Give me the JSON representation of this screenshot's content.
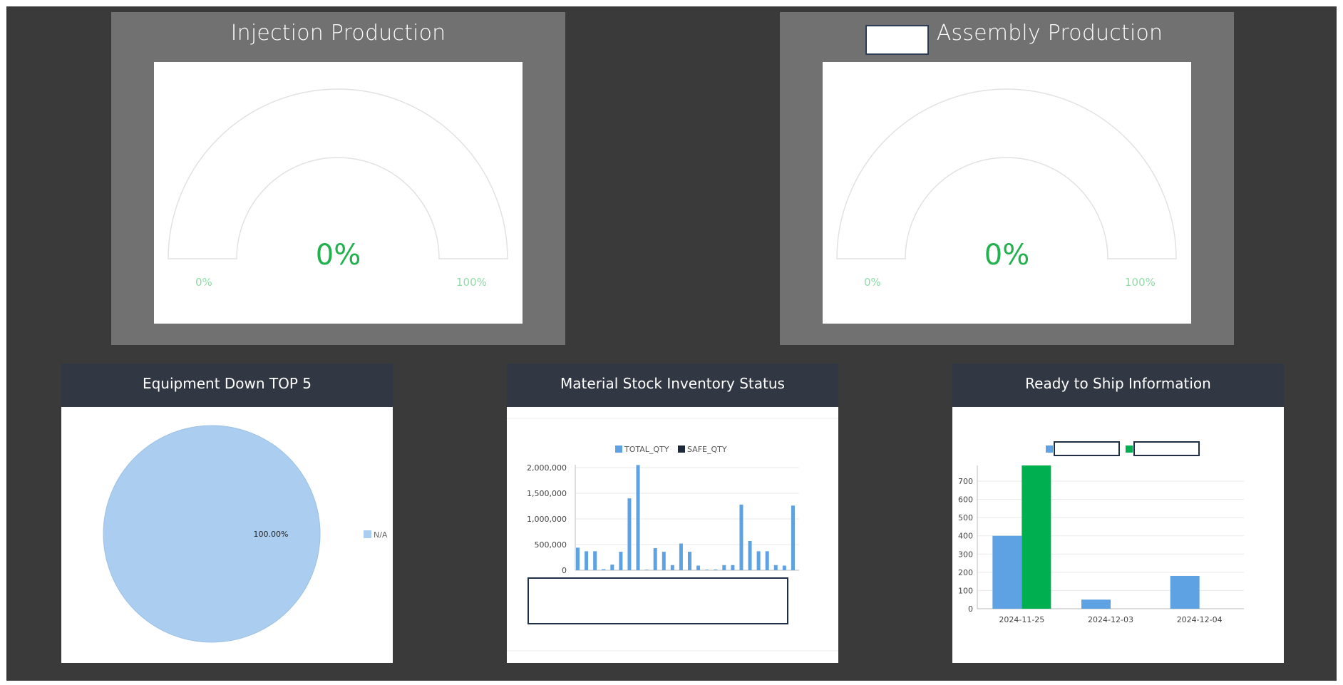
{
  "gauges": [
    {
      "title": "Injection Production",
      "value_label": "0%",
      "min_label": "0%",
      "max_label": "100%",
      "value": 0
    },
    {
      "title": "Assembly Production",
      "value_label": "0%",
      "min_label": "0%",
      "max_label": "100%",
      "value": 0
    }
  ],
  "panels": {
    "equipment": {
      "title": "Equipment Down TOP 5"
    },
    "material": {
      "title": "Material Stock Inventory Status"
    },
    "ship": {
      "title": "Ready to Ship Information"
    }
  },
  "colors": {
    "blue": "#5ea2e3",
    "navy": "#1e2a3a",
    "green": "#00b050",
    "pie": "#abcdef"
  },
  "chart_data": [
    {
      "type": "pie",
      "categories": [
        "N/A"
      ],
      "values": [
        100.0
      ],
      "slice_label": "100.00%"
    },
    {
      "type": "bar",
      "series": [
        {
          "name": "TOTAL_QTY",
          "values": [
            440000,
            370000,
            370000,
            20000,
            110000,
            360000,
            1400000,
            2050000,
            0,
            430000,
            360000,
            100000,
            520000,
            360000,
            90000,
            0,
            10000,
            100000,
            100000,
            1280000,
            570000,
            370000,
            370000,
            100000,
            90000,
            1260000
          ]
        },
        {
          "name": "SAFE_QTY",
          "values": []
        }
      ],
      "y_ticks": [
        "0",
        "500,000",
        "1,000,000",
        "1,500,000",
        "2,000,000"
      ],
      "ylim": [
        0,
        2000000
      ]
    },
    {
      "type": "bar",
      "categories": [
        "2024-11-25",
        "2024-12-03",
        "2024-12-04"
      ],
      "series": [
        {
          "values": [
            400,
            50,
            180
          ]
        },
        {
          "values": [
            790,
            0,
            0
          ]
        }
      ],
      "y_ticks": [
        "0",
        "100",
        "200",
        "300",
        "400",
        "500",
        "600",
        "700"
      ],
      "ylim": [
        0,
        790
      ]
    }
  ]
}
